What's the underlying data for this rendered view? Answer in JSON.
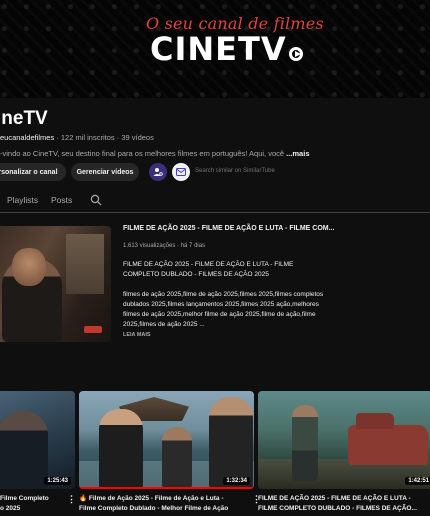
{
  "banner": {
    "tagline": "O seu canal de filmes",
    "logo_text": "CINETV"
  },
  "channel": {
    "name": "ineTV",
    "handle": "eucanaldefilmes",
    "subscribers": "122 mil inscritos",
    "videos_count": "39 vídeos",
    "description": "-vindo ao CineTV, seu destino final para os melhores filmes em português! Aqui, você",
    "more_label": "...mais",
    "customize_label": "ersonalizar o canal",
    "manage_label": "Gerenciar vídeos",
    "search_similar": "Search similar on SimilarTube"
  },
  "tabs": [
    {
      "label": "Playlists"
    },
    {
      "label": "Posts"
    }
  ],
  "featured": {
    "title": "FILME DE AÇÃO 2025 - FILME DE AÇÃO E LUTA - FILME COM...",
    "views": "1.613 visualizações",
    "age": "há 7 dias",
    "desc_line1": "FILME DE AÇÃO 2025 - FILME DE AÇÃO E LUTA - FILME COMPLETO DUBLADO - FILMES DE AÇÃO 2025",
    "desc_line2": "filmes de ação 2025,filme de ação 2025,filmes 2025,filmes completos dublados 2025,filmes lançamentos 2025,filmes 2025 ação,melhores filmes de ação 2025,melhor filme de ação 2025,filme de ação,filme 2025,filmes de ação 2025 ...",
    "read_more": "LEIA MAIS"
  },
  "videos": [
    {
      "title": "Filme Completo",
      "title2": "o 2025",
      "duration": "1:25:43",
      "progress": 0
    },
    {
      "title": "🔥 Filme de Ação 2025 - Filme de Ação e Luta -",
      "title2": "Filme Completo Dublado - Melhor Filme de Ação",
      "duration": "1:32:34",
      "progress": 1.0
    },
    {
      "title": "FILME DE AÇÃO 2025 - FILME DE AÇÃO E LUTA -",
      "title2": "FILME COMPLETO DUBLADO - FILMES DE AÇÃO...",
      "duration": "1:42:51",
      "progress": 0
    }
  ],
  "colors": {
    "background": "#0f0f0f",
    "accent_red": "#ff0000",
    "tagline_red": "#e0443a"
  }
}
